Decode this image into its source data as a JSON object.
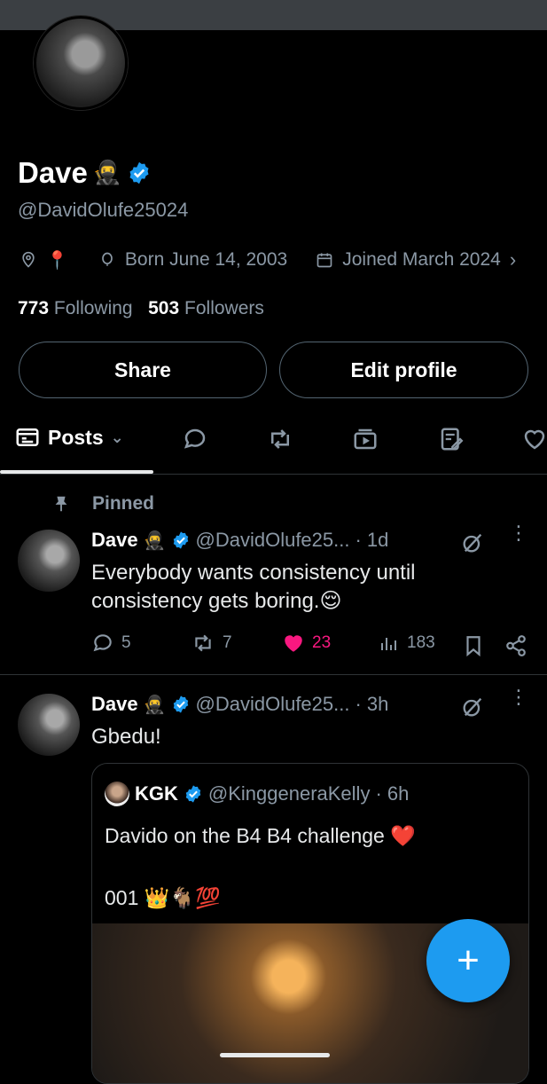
{
  "profile": {
    "name": "Dave",
    "name_emoji": "🥷",
    "handle": "@DavidOlufe25024",
    "location_emoji": "📍",
    "born": "Born June 14, 2003",
    "joined": "Joined March 2024",
    "following_count": "773",
    "following_label": "Following",
    "followers_count": "503",
    "followers_label": "Followers",
    "share_label": "Share",
    "edit_label": "Edit profile"
  },
  "tabs": {
    "posts_label": "Posts"
  },
  "pinned": {
    "label": "Pinned",
    "name": "Dave",
    "emoji": "🥷",
    "handle": "@DavidOlufe25...",
    "time": "· 1d",
    "text_line1": "Everybody wants consistency until",
    "text_line2": "consistency gets boring.😌",
    "replies": "5",
    "reposts": "7",
    "likes": "23",
    "views": "183"
  },
  "post2": {
    "name": "Dave",
    "emoji": "🥷",
    "handle": "@DavidOlufe25...",
    "time": "· 3h",
    "text": "Gbedu!",
    "quote": {
      "name": "KGK",
      "handle": "@KinggeneraKelly",
      "time": "· 6h",
      "text_line1": "Davido on the B4 B4 challenge ❤️",
      "text_line2": "001 👑🐐💯"
    }
  },
  "colors": {
    "accent": "#1d9bf0",
    "like": "#f91880",
    "muted": "#8b98a5"
  },
  "fab_label": "+"
}
